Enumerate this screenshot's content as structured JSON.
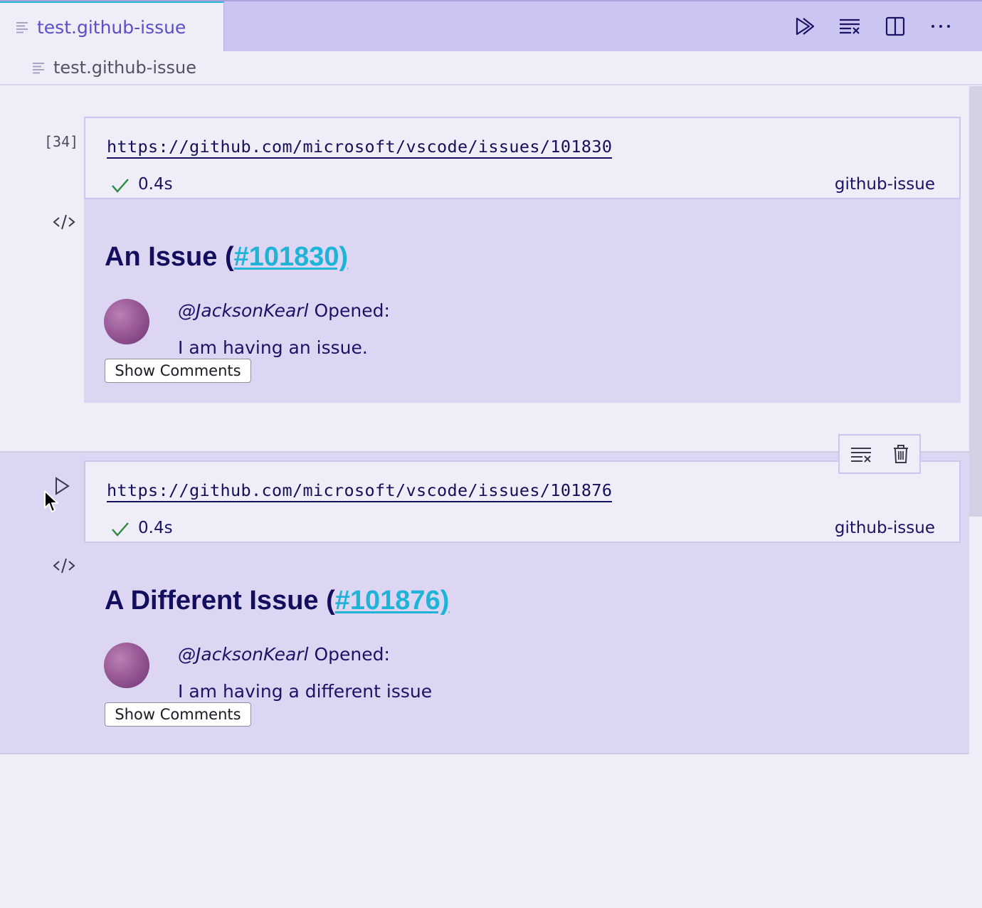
{
  "tab": {
    "title": "test.github-issue",
    "icon": "file-lines-icon"
  },
  "toolbar_actions": [
    {
      "name": "run-all-icon"
    },
    {
      "name": "clear-outputs-icon"
    },
    {
      "name": "split-editor-icon"
    },
    {
      "name": "more-actions-icon"
    }
  ],
  "breadcrumb": {
    "label": "test.github-issue",
    "icon": "file-lines-icon"
  },
  "cells": [
    {
      "execution_count": "[34]",
      "source": "https://github.com/microsoft/vscode/issues/101830",
      "status": "success",
      "duration": "0.4s",
      "renderer": "github-issue",
      "output": {
        "title_prefix": "An Issue (",
        "issue_link": "#101830)",
        "author": "@JacksonKearl",
        "opened_label": " Opened:",
        "body": "I am having an issue.",
        "button": "Show Comments"
      }
    },
    {
      "execution_count": "",
      "source": "https://github.com/microsoft/vscode/issues/101876",
      "status": "success",
      "duration": "0.4s",
      "renderer": "github-issue",
      "output": {
        "title_prefix": "A Different Issue (",
        "issue_link": "#101876)",
        "author": "@JacksonKearl",
        "opened_label": " Opened:",
        "body": "I am having a different issue",
        "button": "Show Comments"
      }
    }
  ],
  "cell_toolbar": [
    {
      "name": "clear-output-icon"
    },
    {
      "name": "delete-icon"
    }
  ],
  "colors": {
    "background": "#efedf7",
    "tabbar": "#cbc5f2",
    "output_bg": "#dcd6f3",
    "link": "#1eb4d7",
    "text": "#1b1466",
    "success": "#2e8b3e",
    "tab_accent": "#28b7d8"
  }
}
